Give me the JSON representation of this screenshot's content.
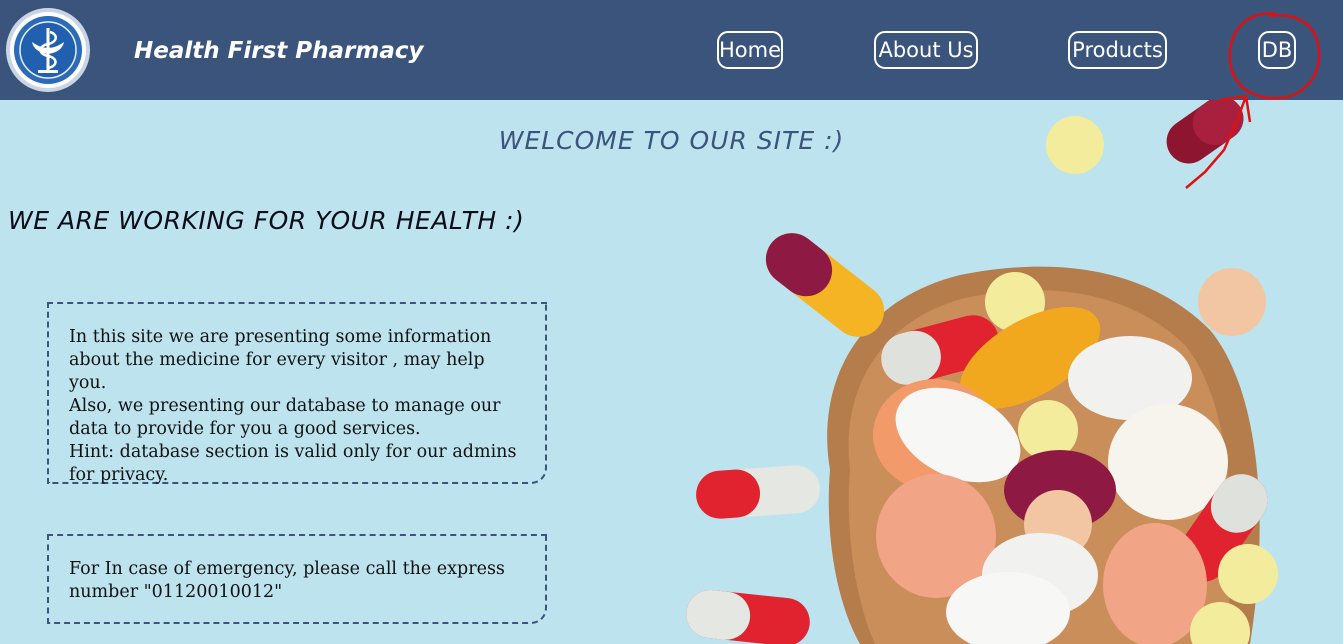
{
  "header": {
    "logo_icon": "pharmacy-bowl-of-hygieia-icon",
    "brand": "Health First Pharmacy",
    "nav": [
      {
        "label": "Home"
      },
      {
        "label": "About Us"
      },
      {
        "label": "Products"
      },
      {
        "label": "DB"
      }
    ]
  },
  "main": {
    "welcome": "WELCOME TO OUR SITE :)",
    "tagline": "WE ARE WORKING FOR YOUR HEALTH :)",
    "info_lines": [
      "In this site we are presenting some information about the medicine for every visitor , may help you.",
      "Also, we presenting our database to manage our data to provide for you a good services.",
      "Hint: database section is valid only for our admins for privacy."
    ],
    "emergency": "For In case of emergency, please call the express number \"01120010012\""
  },
  "colors": {
    "header_bg": "#3b547c",
    "page_bg": "#bde3ee",
    "annotation": "#e01010"
  }
}
